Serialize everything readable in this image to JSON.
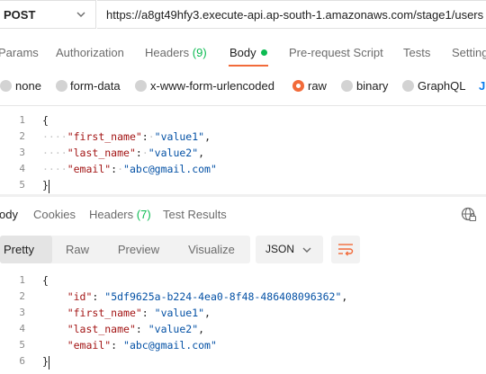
{
  "request": {
    "method": "POST",
    "url": "https://a8gt49hfy3.execute-api.ap-south-1.amazonaws.com/stage1/users"
  },
  "request_tabs": [
    {
      "label": "Params"
    },
    {
      "label": "Authorization"
    },
    {
      "label": "Headers",
      "count": "(9)"
    },
    {
      "label": "Body",
      "active": true
    },
    {
      "label": "Pre-request Script"
    },
    {
      "label": "Tests"
    },
    {
      "label": "Setting"
    }
  ],
  "body_types": [
    {
      "label": "none"
    },
    {
      "label": "form-data"
    },
    {
      "label": "x-www-form-urlencoded"
    },
    {
      "label": "raw",
      "selected": true
    },
    {
      "label": "binary"
    },
    {
      "label": "GraphQL"
    },
    {
      "label": "J"
    }
  ],
  "request_body": {
    "line_numbers": [
      "1",
      "2",
      "3",
      "4",
      "5"
    ],
    "open_brace": "{",
    "close_brace": "}",
    "fields": [
      {
        "key": "\"first_name\"",
        "value": "\"value1\"",
        "sep": ","
      },
      {
        "key": "\"last_name\"",
        "value": "\"value2\"",
        "sep": ","
      },
      {
        "key": "\"email\"",
        "value": "\"abc@gmail.com\"",
        "sep": ""
      }
    ]
  },
  "response_tabs": [
    {
      "label": "ody",
      "active": true
    },
    {
      "label": "Cookies"
    },
    {
      "label": "Headers",
      "count": "(7)"
    },
    {
      "label": "Test Results"
    }
  ],
  "view_modes": [
    "Pretty",
    "Raw",
    "Preview",
    "Visualize"
  ],
  "format": "JSON",
  "response_body": {
    "line_numbers": [
      "1",
      "2",
      "3",
      "4",
      "5",
      "6"
    ],
    "open_brace": "{",
    "close_brace": "}",
    "fields": [
      {
        "key": "\"id\"",
        "value": "\"5df9625a-b224-4ea0-8f48-486408096362\"",
        "sep": ","
      },
      {
        "key": "\"first_name\"",
        "value": "\"value1\"",
        "sep": ","
      },
      {
        "key": "\"last_name\"",
        "value": "\"value2\"",
        "sep": ","
      },
      {
        "key": "\"email\"",
        "value": "\"abc@gmail.com\"",
        "sep": ""
      }
    ]
  },
  "colors": {
    "accent": "#f26b3a",
    "count_green": "#0cbb52",
    "link_blue": "#097bed"
  }
}
